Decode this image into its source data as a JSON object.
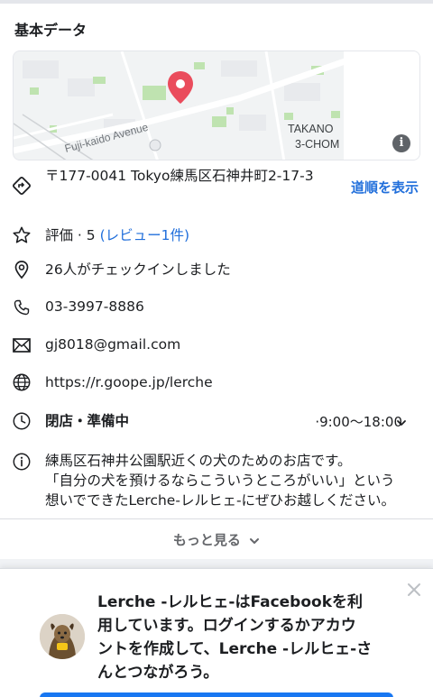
{
  "section_title": "基本データ",
  "map": {
    "street_label": "Fuji-kaido Avenue",
    "area_label_1": "TAKANO",
    "area_label_2": "3-CHOM",
    "info_icon": "info-icon"
  },
  "address": {
    "text": "〒177-0041 Tokyo練馬区石神井町2-17-3",
    "directions_label": "道順を表示",
    "icon": "directions-icon"
  },
  "rating": {
    "label": "評価 · 5",
    "reviews_link": "(レビュー1件)",
    "icon": "star-icon"
  },
  "checkins": {
    "text": "26人がチェックインしました",
    "icon": "location-pin-icon"
  },
  "phone": {
    "text": "03-3997-8886",
    "icon": "phone-icon"
  },
  "email": {
    "text": "gj8018@gmail.com",
    "icon": "mail-icon"
  },
  "website": {
    "text": "https://r.goope.jp/lerche",
    "icon": "globe-icon"
  },
  "hours": {
    "status": "閉店・準備中",
    "range": "·9:00〜18:00",
    "icon": "clock-icon"
  },
  "about": {
    "line1": "練馬区石神井公園駅近くの犬のためのお店です。",
    "line2": "「自分の犬を預けるならこういうところがいい」という",
    "line3": "想いでできたLerche-レルヒェ-にぜひお越しください。",
    "icon": "info-circle-icon"
  },
  "see_more": "もっと見る",
  "login_prompt": {
    "line1": "Lerche -レルヒェ-はFacebookを利",
    "line2": "用しています。ログインするかアカウ",
    "line3": "ントを作成して、Lerche -レルヒェ-さ",
    "line4": "んとつながろう。"
  },
  "colors": {
    "link": "#216fdb",
    "closed": "#e41e3f",
    "map_pin": "#ea4c5c",
    "facebook_blue": "#1877f2"
  }
}
